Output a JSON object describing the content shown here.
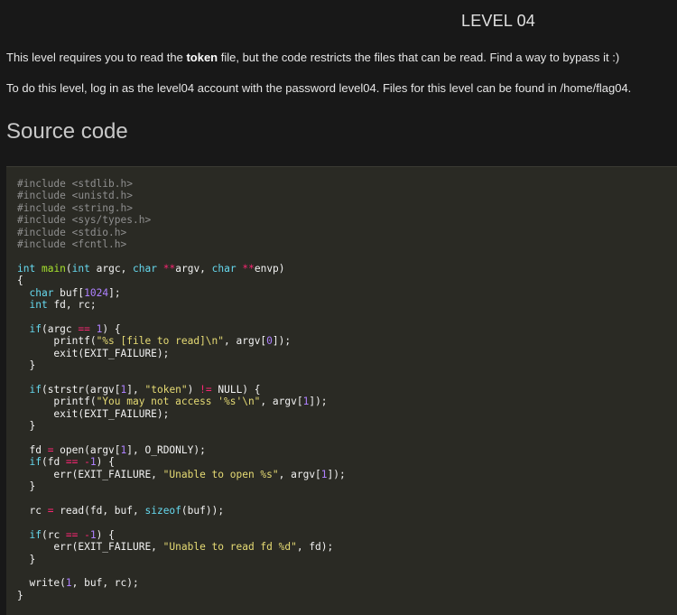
{
  "header": {
    "level_title": "LEVEL 04"
  },
  "intro": {
    "p1_before": "This level requires you to read the ",
    "p1_bold": "token",
    "p1_after": " file, but the code restricts the files that can be read. Find a way to bypass it :)",
    "p2": "To do this level, log in as the level04 account with the password level04. Files for this level can be found in /home/flag04."
  },
  "source": {
    "heading": "Source code",
    "lines": [
      [
        [
          "pre",
          "#include <stdlib.h>"
        ]
      ],
      [
        [
          "pre",
          "#include <unistd.h>"
        ]
      ],
      [
        [
          "pre",
          "#include <string.h>"
        ]
      ],
      [
        [
          "pre",
          "#include <sys/types.h>"
        ]
      ],
      [
        [
          "pre",
          "#include <stdio.h>"
        ]
      ],
      [
        [
          "pre",
          "#include <fcntl.h>"
        ]
      ],
      [],
      [
        [
          "kw",
          "int"
        ],
        [
          "t",
          " "
        ],
        [
          "fn",
          "main"
        ],
        [
          "t",
          "("
        ],
        [
          "kw",
          "int"
        ],
        [
          "t",
          " argc, "
        ],
        [
          "kw",
          "char"
        ],
        [
          "t",
          " "
        ],
        [
          "op",
          "**"
        ],
        [
          "t",
          "argv, "
        ],
        [
          "kw",
          "char"
        ],
        [
          "t",
          " "
        ],
        [
          "op",
          "**"
        ],
        [
          "t",
          "envp)"
        ]
      ],
      [
        [
          "t",
          "{"
        ]
      ],
      [
        [
          "t",
          "  "
        ],
        [
          "kw",
          "char"
        ],
        [
          "t",
          " buf["
        ],
        [
          "num",
          "1024"
        ],
        [
          "t",
          "];"
        ]
      ],
      [
        [
          "t",
          "  "
        ],
        [
          "kw",
          "int"
        ],
        [
          "t",
          " fd, rc;"
        ]
      ],
      [],
      [
        [
          "t",
          "  "
        ],
        [
          "kw",
          "if"
        ],
        [
          "t",
          "(argc "
        ],
        [
          "op",
          "=="
        ],
        [
          "t",
          " "
        ],
        [
          "num",
          "1"
        ],
        [
          "t",
          ") {"
        ]
      ],
      [
        [
          "t",
          "      printf("
        ],
        [
          "str",
          "\"%s [file to read]\\n\""
        ],
        [
          "t",
          ", argv["
        ],
        [
          "num",
          "0"
        ],
        [
          "t",
          "]);"
        ]
      ],
      [
        [
          "t",
          "      exit(EXIT_FAILURE);"
        ]
      ],
      [
        [
          "t",
          "  }"
        ]
      ],
      [],
      [
        [
          "t",
          "  "
        ],
        [
          "kw",
          "if"
        ],
        [
          "t",
          "(strstr(argv["
        ],
        [
          "num",
          "1"
        ],
        [
          "t",
          "], "
        ],
        [
          "str",
          "\"token\""
        ],
        [
          "t",
          ") "
        ],
        [
          "op",
          "!="
        ],
        [
          "t",
          " NULL) {"
        ]
      ],
      [
        [
          "t",
          "      printf("
        ],
        [
          "str",
          "\"You may not access '%s'\\n\""
        ],
        [
          "t",
          ", argv["
        ],
        [
          "num",
          "1"
        ],
        [
          "t",
          "]);"
        ]
      ],
      [
        [
          "t",
          "      exit(EXIT_FAILURE);"
        ]
      ],
      [
        [
          "t",
          "  }"
        ]
      ],
      [],
      [
        [
          "t",
          "  fd "
        ],
        [
          "op",
          "="
        ],
        [
          "t",
          " open(argv["
        ],
        [
          "num",
          "1"
        ],
        [
          "t",
          "], O_RDONLY);"
        ]
      ],
      [
        [
          "t",
          "  "
        ],
        [
          "kw",
          "if"
        ],
        [
          "t",
          "(fd "
        ],
        [
          "op",
          "=="
        ],
        [
          "t",
          " "
        ],
        [
          "op",
          "-"
        ],
        [
          "num",
          "1"
        ],
        [
          "t",
          ") {"
        ]
      ],
      [
        [
          "t",
          "      err(EXIT_FAILURE, "
        ],
        [
          "str",
          "\"Unable to open %s\""
        ],
        [
          "t",
          ", argv["
        ],
        [
          "num",
          "1"
        ],
        [
          "t",
          "]);"
        ]
      ],
      [
        [
          "t",
          "  }"
        ]
      ],
      [],
      [
        [
          "t",
          "  rc "
        ],
        [
          "op",
          "="
        ],
        [
          "t",
          " read(fd, buf, "
        ],
        [
          "kw",
          "sizeof"
        ],
        [
          "t",
          "(buf));"
        ]
      ],
      [],
      [
        [
          "t",
          "  "
        ],
        [
          "kw",
          "if"
        ],
        [
          "t",
          "(rc "
        ],
        [
          "op",
          "=="
        ],
        [
          "t",
          " "
        ],
        [
          "op",
          "-"
        ],
        [
          "num",
          "1"
        ],
        [
          "t",
          ") {"
        ]
      ],
      [
        [
          "t",
          "      err(EXIT_FAILURE, "
        ],
        [
          "str",
          "\"Unable to read fd %d\""
        ],
        [
          "t",
          ", fd);"
        ]
      ],
      [
        [
          "t",
          "  }"
        ]
      ],
      [],
      [
        [
          "t",
          "  write("
        ],
        [
          "num",
          "1"
        ],
        [
          "t",
          ", buf, rc);"
        ]
      ],
      [
        [
          "t",
          "}"
        ]
      ]
    ]
  }
}
